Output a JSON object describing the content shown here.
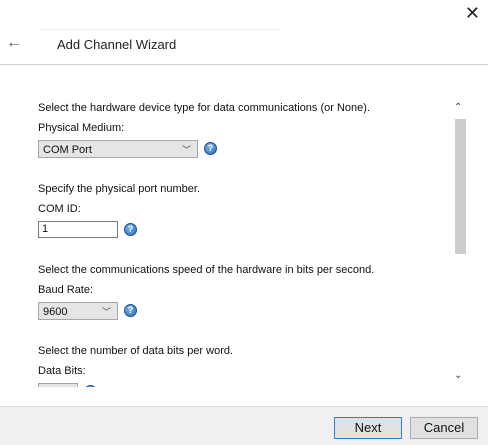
{
  "window": {
    "title": "Add Channel Wizard",
    "close_icon": "close-icon",
    "back_icon": "back-arrow-icon"
  },
  "sections": {
    "physical_medium": {
      "description": "Select the hardware device type for data communications (or None).",
      "label": "Physical Medium:",
      "value": "COM Port"
    },
    "com_id": {
      "description": "Specify the physical port number.",
      "label": "COM ID:",
      "value": "1"
    },
    "baud_rate": {
      "description": "Select the communications speed of the hardware in bits per second.",
      "label": "Baud Rate:",
      "value": "9600"
    },
    "data_bits": {
      "description": "Select the number of data bits per word.",
      "label": "Data Bits:"
    }
  },
  "help_glyph": "?",
  "scrollbar": {
    "up_glyph": "⌃",
    "down_glyph": "⌄"
  },
  "footer": {
    "next_label": "Next",
    "cancel_label": "Cancel"
  }
}
